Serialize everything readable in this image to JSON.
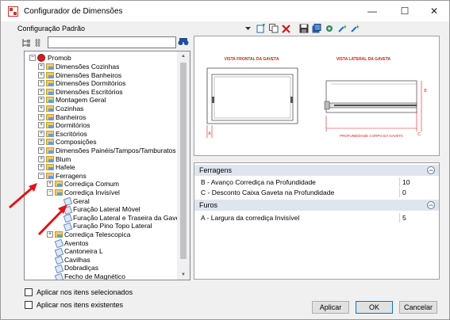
{
  "window": {
    "title": "Configurador de Dimensões",
    "minimize": "—",
    "maximize": "☐",
    "close": "✕"
  },
  "config_label": "Configuração Padrão",
  "toolbar_icons": [
    "dropdown-icon",
    "new-icon",
    "copy-icon",
    "delete-icon",
    "save-icon",
    "export-icon",
    "settings-icon",
    "wand-icon",
    "wand-2-icon"
  ],
  "tree": {
    "root": "Promob",
    "items": [
      {
        "label": "Dimensões Cozinhas",
        "depth": 1,
        "kind": "folder",
        "expander": "+"
      },
      {
        "label": "Dimensões Banheiros",
        "depth": 1,
        "kind": "folder",
        "expander": "+"
      },
      {
        "label": "Dimensões Dormitórios",
        "depth": 1,
        "kind": "folder",
        "expander": "+"
      },
      {
        "label": "Dimensões Escritórios",
        "depth": 1,
        "kind": "folder",
        "expander": "+"
      },
      {
        "label": "Montagem Geral",
        "depth": 1,
        "kind": "folder",
        "expander": "+"
      },
      {
        "label": "Cozinhas",
        "depth": 1,
        "kind": "folder",
        "expander": "+"
      },
      {
        "label": "Banheiros",
        "depth": 1,
        "kind": "folder",
        "expander": "+"
      },
      {
        "label": "Dormitórios",
        "depth": 1,
        "kind": "folder",
        "expander": "+"
      },
      {
        "label": "Escritórios",
        "depth": 1,
        "kind": "folder",
        "expander": "+"
      },
      {
        "label": "Composições",
        "depth": 1,
        "kind": "folder",
        "expander": "+"
      },
      {
        "label": "Dimensões Painéis/Tampos/Tamburatos",
        "depth": 1,
        "kind": "folder",
        "expander": "+"
      },
      {
        "label": "Blum",
        "depth": 1,
        "kind": "folder",
        "expander": "+"
      },
      {
        "label": "Hafele",
        "depth": 1,
        "kind": "folder",
        "expander": "+"
      },
      {
        "label": "Ferragens",
        "depth": 1,
        "kind": "folder",
        "expander": "−"
      },
      {
        "label": "Corrediça Comum",
        "depth": 2,
        "kind": "folder",
        "expander": "+"
      },
      {
        "label": "Corrediça Invisível",
        "depth": 2,
        "kind": "folder",
        "expander": "−"
      },
      {
        "label": "Geral",
        "depth": 3,
        "kind": "doc",
        "expander": ""
      },
      {
        "label": "Furação Lateral Móvel",
        "depth": 3,
        "kind": "doc",
        "expander": ""
      },
      {
        "label": "Furação Lateral e Traseira da Gaveta",
        "depth": 3,
        "kind": "doc",
        "expander": ""
      },
      {
        "label": "Furação Pino Topo Lateral",
        "depth": 3,
        "kind": "doc",
        "expander": ""
      },
      {
        "label": "Corrediça Telescopica",
        "depth": 2,
        "kind": "folder",
        "expander": "+"
      },
      {
        "label": "Aventos",
        "depth": 2,
        "kind": "doc",
        "expander": ""
      },
      {
        "label": "Cantoneira L",
        "depth": 2,
        "kind": "doc",
        "expander": ""
      },
      {
        "label": "Cavilhas",
        "depth": 2,
        "kind": "doc",
        "expander": ""
      },
      {
        "label": "Dobradiças",
        "depth": 2,
        "kind": "doc",
        "expander": ""
      },
      {
        "label": "Fecho de Magnético",
        "depth": 2,
        "kind": "doc",
        "expander": ""
      }
    ]
  },
  "preview": {
    "front_title": "VISTA FRONTAL DA GAVETA",
    "side_title": "VISTA LATERAL DA GAVETA",
    "marker_a": "A",
    "marker_b": "B",
    "marker_c": "C",
    "depth_label": "PROFUNDIDADE CORPO DA GAVETA",
    "line_color": "#d81b1b"
  },
  "properties": {
    "ferragens_header": "Ferragens",
    "ferragens_rows": [
      {
        "name": "B - Avanço Corrediça na Profundidade",
        "value": "10"
      },
      {
        "name": "C - Desconto Caixa Gaveta na Profundidade",
        "value": "0"
      }
    ],
    "furos_header": "Furos",
    "furos_rows": [
      {
        "name": "A - Largura da corrediça Invisível",
        "value": "5"
      }
    ]
  },
  "checkboxes": {
    "selected_items": "Aplicar nos itens selecionados",
    "existing_items": "Aplicar nos itens existentes"
  },
  "buttons": {
    "apply": "Aplicar",
    "ok": "OK",
    "cancel": "Cancelar"
  },
  "colors": {
    "arrow": "#e0141b",
    "ok_border": "#0078d7"
  }
}
